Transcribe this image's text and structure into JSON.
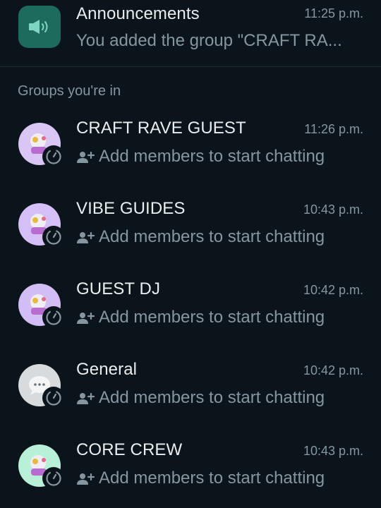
{
  "announcements": {
    "name": "Announcements",
    "time": "11:25 p.m.",
    "preview": "You added the group \"CRAFT RA...",
    "icon": "megaphone-icon"
  },
  "section_label": "Groups you're in",
  "groups": [
    {
      "name": "CRAFT RAVE GUEST",
      "time": "11:26 p.m.",
      "preview": "Add members to start chatting",
      "avatar_color": "#d9c6f5"
    },
    {
      "name": "VIBE GUIDES",
      "time": "10:43 p.m.",
      "preview": "Add members to start chatting",
      "avatar_color": "#d4bff7"
    },
    {
      "name": "GUEST DJ",
      "time": "10:42 p.m.",
      "preview": "Add members to start chatting",
      "avatar_color": "#d3bdf5"
    },
    {
      "name": "General",
      "time": "10:42 p.m.",
      "preview": "Add members to start chatting",
      "avatar_color": "#d7dbde"
    },
    {
      "name": "CORE CREW",
      "time": "10:43 p.m.",
      "preview": "Add members to start chatting",
      "avatar_color": "#b9f0d8"
    }
  ],
  "colors": {
    "background": "#0b141a",
    "primary_text": "#e9edef",
    "secondary_text": "#8696a0",
    "announcement_avatar": "#1d6b5c"
  }
}
